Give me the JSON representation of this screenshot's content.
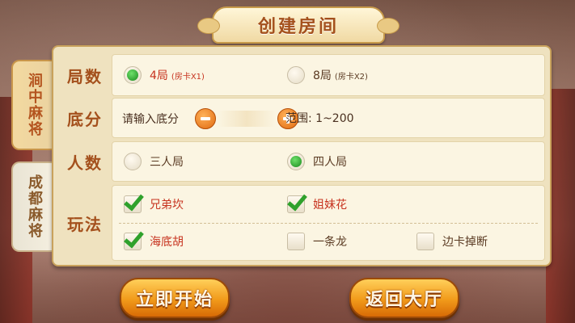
{
  "title": "创建房间",
  "tabs": [
    {
      "label": "涧中麻将",
      "active": true
    },
    {
      "label": "成都麻将",
      "active": false
    }
  ],
  "rounds": {
    "label": "局数",
    "options": [
      {
        "label": "4局",
        "note": "(房卡X1)",
        "selected": true
      },
      {
        "label": "8局",
        "note": "(房卡X2)",
        "selected": false
      }
    ]
  },
  "base_score": {
    "label": "底分",
    "placeholder": "请输入底分",
    "range": "范围: 1~200"
  },
  "players": {
    "label": "人数",
    "options": [
      {
        "label": "三人局",
        "selected": false
      },
      {
        "label": "四人局",
        "selected": true
      }
    ]
  },
  "play_rules": {
    "label": "玩法",
    "options": [
      {
        "label": "兄弟坎",
        "checked": true
      },
      {
        "label": "姐妹花",
        "checked": true
      },
      {
        "label": "海底胡",
        "checked": true
      },
      {
        "label": "一条龙",
        "checked": false
      },
      {
        "label": "边卡掉断",
        "checked": false
      }
    ]
  },
  "buttons": {
    "start": "立即开始",
    "back": "返回大厅"
  },
  "colors": {
    "accent": "#a4501c",
    "selected_green": "#1a8a1e",
    "checked_text": "#c7331f",
    "button_orange": "#f19a1a"
  }
}
